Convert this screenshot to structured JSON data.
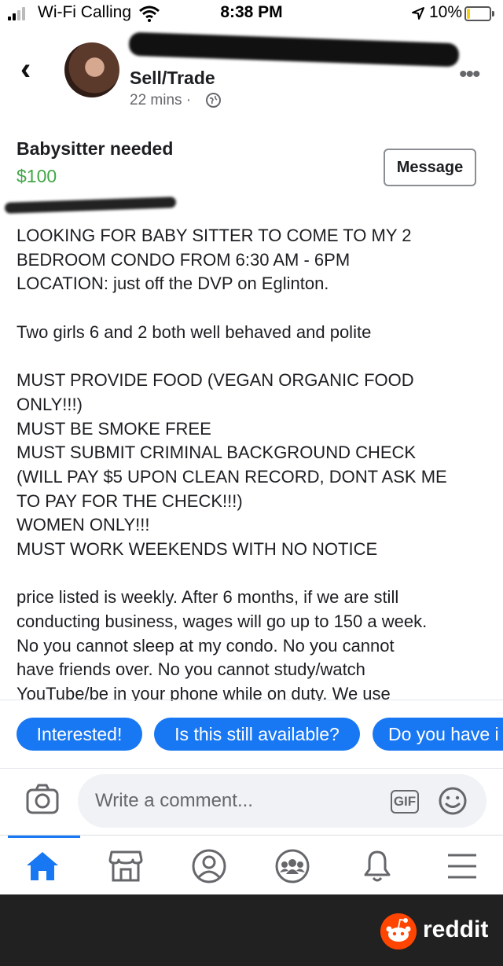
{
  "status_bar": {
    "carrier": "Wi-Fi Calling",
    "time": "8:38 PM",
    "battery": "10%"
  },
  "header": {
    "group_name": "Sell/Trade",
    "time_ago": "22 mins ·"
  },
  "listing": {
    "title": "Babysitter needed",
    "price": "$100",
    "message_button": "Message",
    "description_lines": [
      "LOOKING FOR BABY SITTER TO COME TO MY 2",
      "BEDROOM CONDO FROM 6:30 AM - 6PM",
      "LOCATION: just off the DVP on Eglinton.",
      "",
      "Two girls 6 and 2 both well behaved and polite",
      "",
      "MUST PROVIDE FOOD (VEGAN ORGANIC FOOD",
      "ONLY!!!)",
      "MUST BE SMOKE FREE",
      "MUST SUBMIT CRIMINAL BACKGROUND CHECK",
      "(WILL PAY $5 UPON CLEAN RECORD, DONT ASK ME",
      "TO PAY FOR THE CHECK!!!)",
      "WOMEN ONLY!!!",
      "MUST WORK WEEKENDS WITH NO NOTICE",
      "",
      "price listed is weekly. After 6 months, if we are still",
      "conducting business, wages will go up to 150 a week.",
      "No you cannot sleep at my condo. No you cannot",
      "have friends over. No you cannot study/watch",
      "YouTube/be in your phone while on duty. We use"
    ]
  },
  "quick_replies": [
    "Interested!",
    "Is this still available?",
    "Do you have i"
  ],
  "comment_bar": {
    "placeholder": "Write a comment...",
    "gif_label": "GIF"
  },
  "bottom_nav": [
    "home-icon",
    "marketplace-icon",
    "profile-icon",
    "groups-icon",
    "notifications-icon",
    "menu-icon"
  ],
  "footer": {
    "brand": "reddit"
  },
  "colors": {
    "accent": "#1877f2",
    "price": "#42a547",
    "footer_bg": "#212121",
    "reddit": "#ff4500"
  }
}
